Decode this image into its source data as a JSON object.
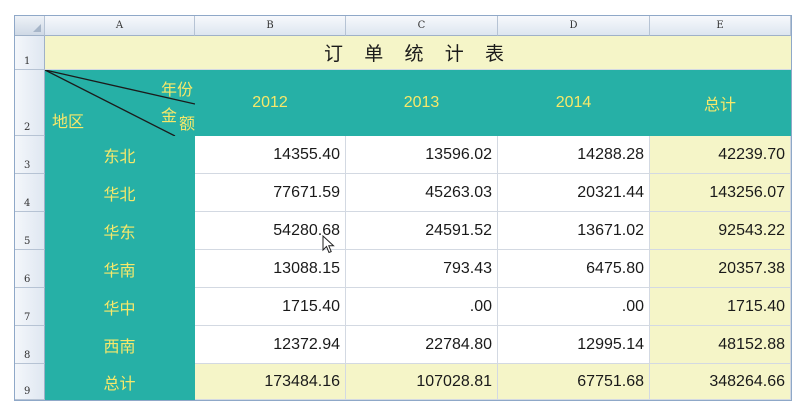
{
  "columns": [
    "A",
    "B",
    "C",
    "D",
    "E"
  ],
  "rows": [
    "1",
    "2",
    "3",
    "4",
    "5",
    "6",
    "7",
    "8",
    "9"
  ],
  "title": "订 单 统 计 表",
  "header": {
    "year_label": "年份",
    "amount_label_1": "金",
    "amount_label_2": "额",
    "region_label": "地区",
    "years": [
      "2012",
      "2013",
      "2014"
    ],
    "total": "总计"
  },
  "data": [
    {
      "region": "东北",
      "v2012": "14355.40",
      "v2013": "13596.02",
      "v2014": "14288.28",
      "total": "42239.70"
    },
    {
      "region": "华北",
      "v2012": "77671.59",
      "v2013": "45263.03",
      "v2014": "20321.44",
      "total": "143256.07"
    },
    {
      "region": "华东",
      "v2012": "54280.68",
      "v2013": "24591.52",
      "v2014": "13671.02",
      "total": "92543.22"
    },
    {
      "region": "华南",
      "v2012": "13088.15",
      "v2013": "793.43",
      "v2014": "6475.80",
      "total": "20357.38"
    },
    {
      "region": "华中",
      "v2012": "1715.40",
      "v2013": ".00",
      "v2014": ".00",
      "total": "1715.40"
    },
    {
      "region": "西南",
      "v2012": "12372.94",
      "v2013": "22784.80",
      "v2014": "12995.14",
      "total": "48152.88"
    }
  ],
  "grand_total": {
    "region": "总计",
    "v2012": "173484.16",
    "v2013": "107028.81",
    "v2014": "67751.68",
    "total": "348264.66"
  },
  "colors": {
    "teal": "#26b0a6",
    "header_text": "#f7e86a",
    "cream": "#f5f5c8"
  }
}
